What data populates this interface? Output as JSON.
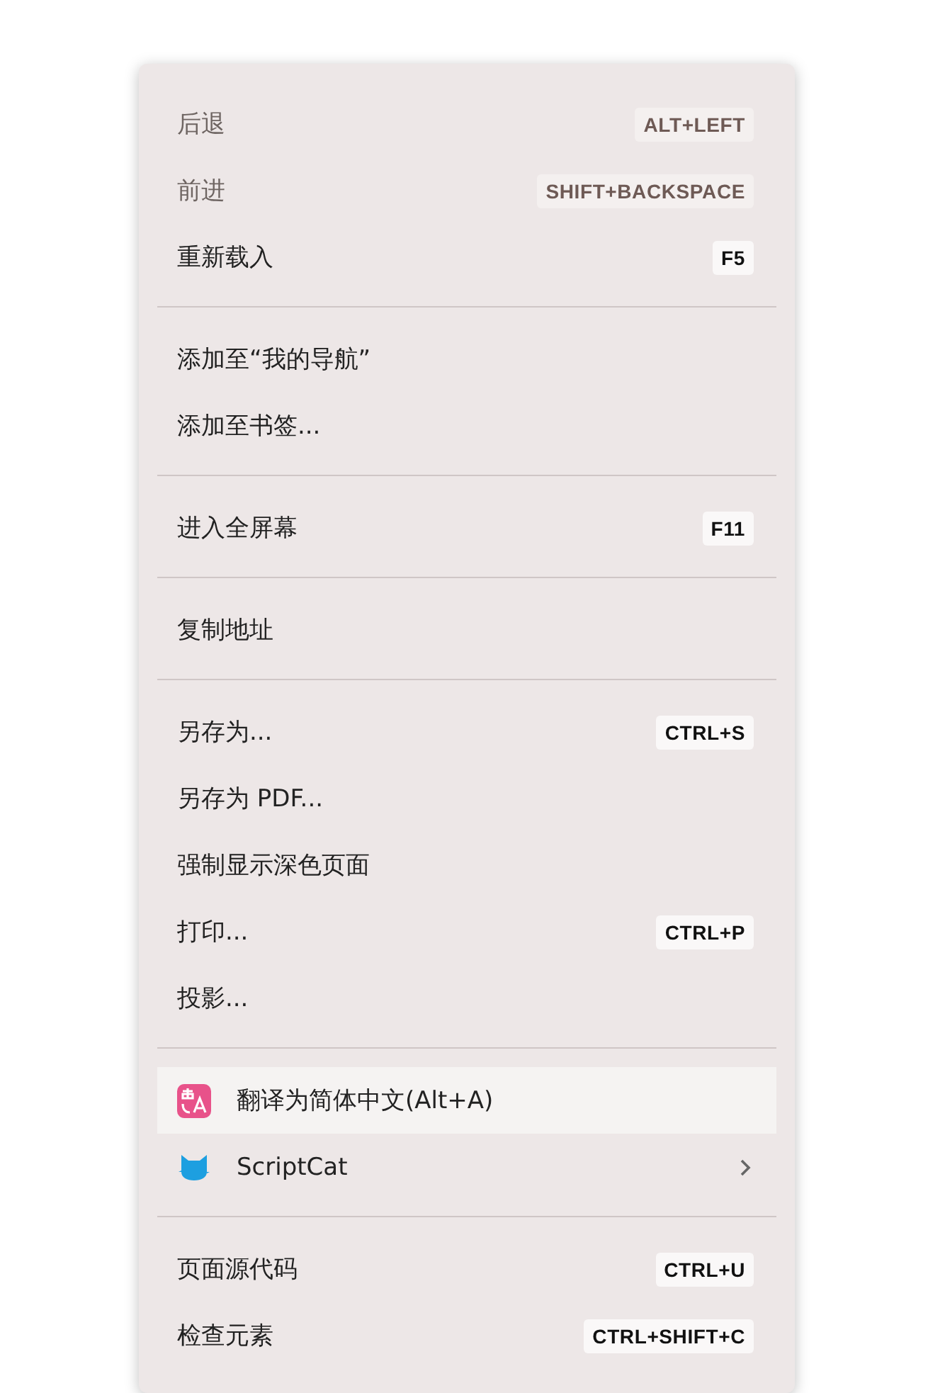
{
  "context_menu": {
    "groups": [
      {
        "items": [
          {
            "label": "后退",
            "shortcut": "ALT+LEFT",
            "disabled": true,
            "selected": false
          },
          {
            "label": "前进",
            "shortcut": "SHIFT+BACKSPACE",
            "disabled": true,
            "selected": false
          },
          {
            "label": "重新载入",
            "shortcut": "F5",
            "disabled": false,
            "selected": false
          }
        ]
      },
      {
        "items": [
          {
            "label": "添加至“我的导航”",
            "disabled": false,
            "selected": false
          },
          {
            "label": "添加至书签...",
            "disabled": false,
            "selected": false
          }
        ]
      },
      {
        "items": [
          {
            "label": "进入全屏幕",
            "shortcut": "F11",
            "disabled": false,
            "selected": false
          }
        ]
      },
      {
        "items": [
          {
            "label": "复制地址",
            "disabled": false,
            "selected": false
          }
        ]
      },
      {
        "items": [
          {
            "label": "另存为...",
            "shortcut": "CTRL+S",
            "disabled": false,
            "selected": false
          },
          {
            "label": "另存为 PDF...",
            "disabled": false,
            "selected": false
          },
          {
            "label": "强制显示深色页面",
            "disabled": false,
            "selected": false
          },
          {
            "label": "打印...",
            "shortcut": "CTRL+P",
            "disabled": false,
            "selected": false
          },
          {
            "label": "投影...",
            "disabled": false,
            "selected": false
          }
        ]
      },
      {
        "items": [
          {
            "label": "翻译为简体中文(Alt+A)",
            "kind": "translate",
            "disabled": false,
            "selected": true
          },
          {
            "label": "ScriptCat",
            "kind": "cat",
            "submenu": true,
            "disabled": false,
            "selected": false
          }
        ]
      },
      {
        "items": [
          {
            "label": "页面源代码",
            "shortcut": "CTRL+U",
            "disabled": false,
            "selected": false
          },
          {
            "label": "检查元素",
            "shortcut": "CTRL+SHIFT+C",
            "disabled": false,
            "selected": false
          }
        ]
      }
    ]
  }
}
